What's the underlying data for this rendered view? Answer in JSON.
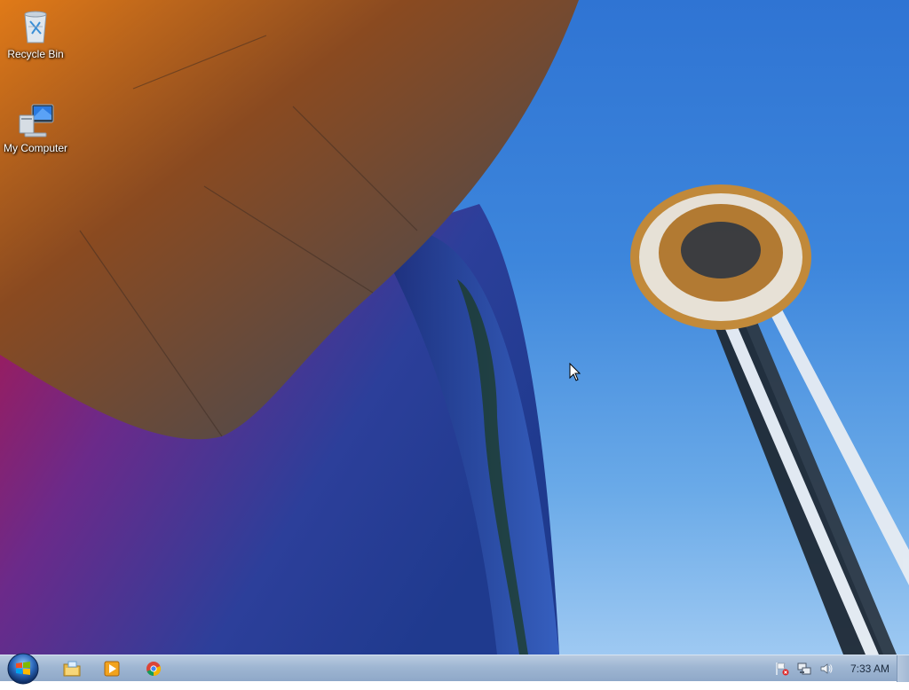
{
  "desktop": {
    "icons": [
      {
        "label": "Recycle Bin",
        "icon": "recycle-bin-icon"
      },
      {
        "label": "My Computer",
        "icon": "computer-icon"
      }
    ]
  },
  "taskbar": {
    "start_icon": "windows-logo-icon",
    "pinned": [
      {
        "name": "Windows Explorer",
        "icon": "folder-icon"
      },
      {
        "name": "Windows Media Player",
        "icon": "media-player-icon"
      },
      {
        "name": "Google Chrome",
        "icon": "chrome-icon"
      }
    ],
    "tray": {
      "icons": [
        "action-center-flag-icon",
        "network-icon",
        "volume-icon"
      ],
      "clock": "7:33 AM"
    }
  },
  "colors": {
    "sky_blue": "#2f74d3",
    "taskbar": "#9fb6d2",
    "building_orange": "#c25a10"
  }
}
